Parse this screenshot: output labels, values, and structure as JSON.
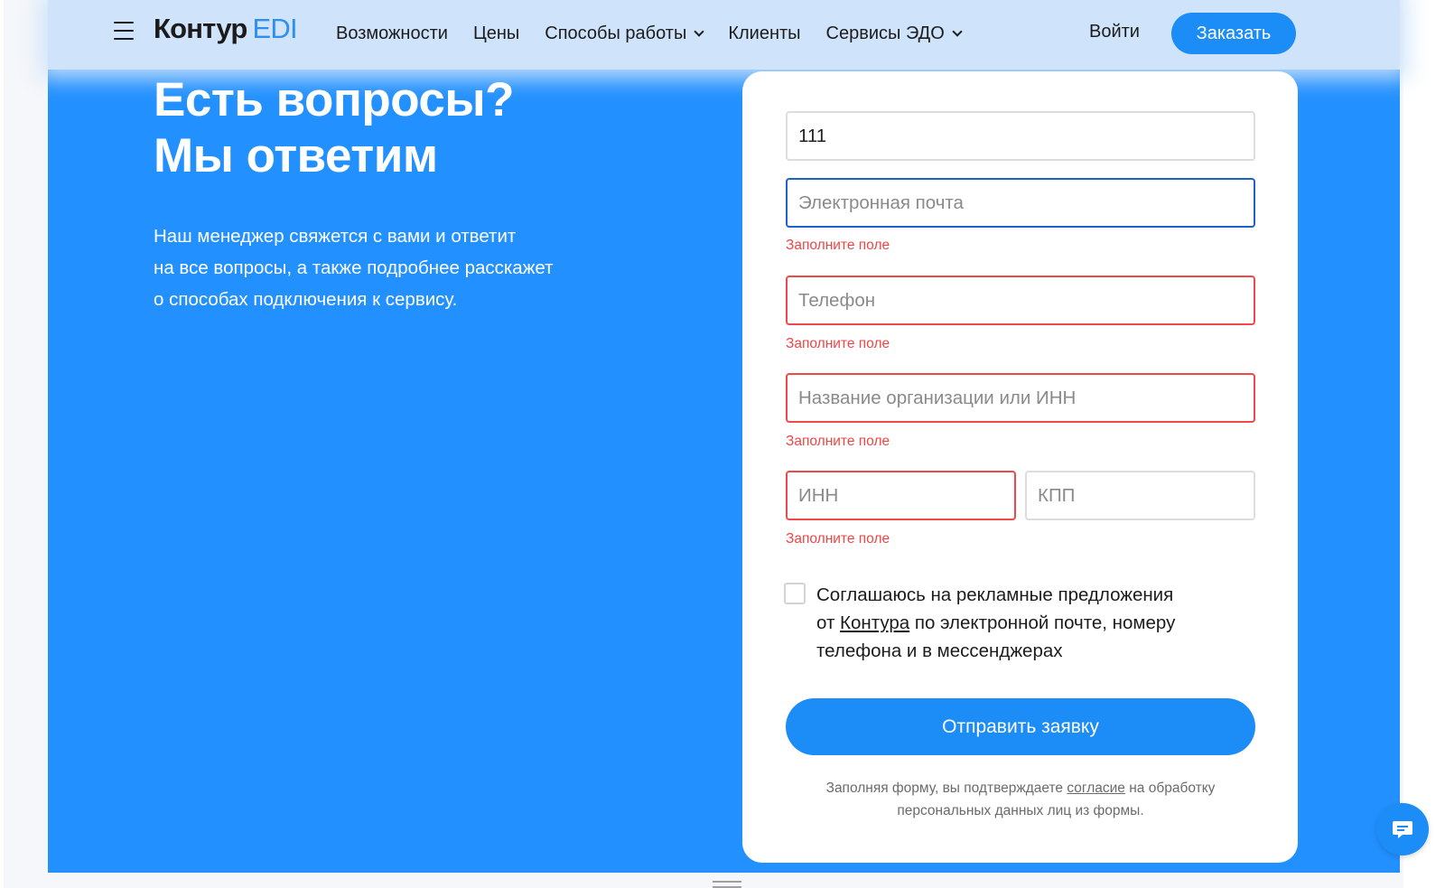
{
  "header": {
    "logo_main": "Контур",
    "logo_accent": "EDI",
    "nav": [
      {
        "label": "Возможности"
      },
      {
        "label": "Цены"
      },
      {
        "label": "Способы работы"
      },
      {
        "label": "Клиенты"
      },
      {
        "label": "Сервисы ЭДО"
      }
    ],
    "login_label": "Войти",
    "order_label": "Заказать"
  },
  "hero": {
    "title_line1": "Есть вопросы?",
    "title_line2": "Мы ответим",
    "text_line1": "Наш менеджер свяжется с вами и ответит",
    "text_line2": "на все вопросы, а также подробнее расскажет",
    "text_line3": "о способах подключения к сервису."
  },
  "form": {
    "name_value": "111",
    "email_placeholder": "Электронная почта",
    "phone_placeholder": "Телефон",
    "org_placeholder": "Название организации или ИНН",
    "inn_placeholder": "ИНН",
    "kpp_placeholder": "КПП",
    "error_text": "Заполните поле",
    "consent_line1": "Соглашаюсь на рекламные предложения",
    "consent_line2_before": "от ",
    "consent_link": "Контура",
    "consent_line2_after": " по электронной почте, номеру",
    "consent_line3": "телефона и в мессенджерах",
    "submit_label": "Отправить заявку",
    "footnote_before": "Заполняя форму, вы подтверждаете ",
    "footnote_link": "согласие",
    "footnote_after": " на обработку",
    "footnote_line2": "персональных данных лиц из формы."
  },
  "icons": {
    "menu": "menu-icon",
    "chevron": "chevron-down-icon",
    "chat": "chat-icon"
  },
  "colors": {
    "primary_blue": "#2290ff",
    "button_blue": "#1c8cf6",
    "header_bg": "#cfe4fb",
    "error_red": "#f04848",
    "focus_blue": "#1a64c8"
  }
}
